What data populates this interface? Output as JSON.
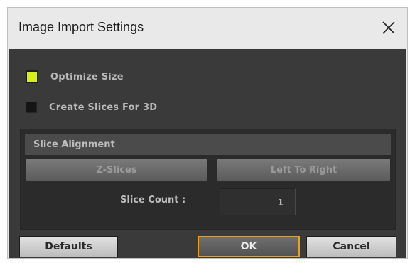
{
  "window": {
    "title": "Image Import Settings"
  },
  "options": {
    "optimize_size": {
      "label": "Optimize Size",
      "checked": true
    },
    "create_slices": {
      "label": "Create Slices For 3D",
      "checked": false
    }
  },
  "slice_panel": {
    "header": "Slice Alignment",
    "z_slices_label": "Z-Slices",
    "left_to_right_label": "Left To Right",
    "count_label": "Slice Count :",
    "count_value": "1"
  },
  "buttons": {
    "defaults": "Defaults",
    "ok": "OK",
    "cancel": "Cancel"
  },
  "colors": {
    "checkbox_on": "#d6f01c",
    "ok_outline": "#e8a21c",
    "panel_bg": "#3a3a3a"
  },
  "icons": {
    "close": "close-icon"
  }
}
